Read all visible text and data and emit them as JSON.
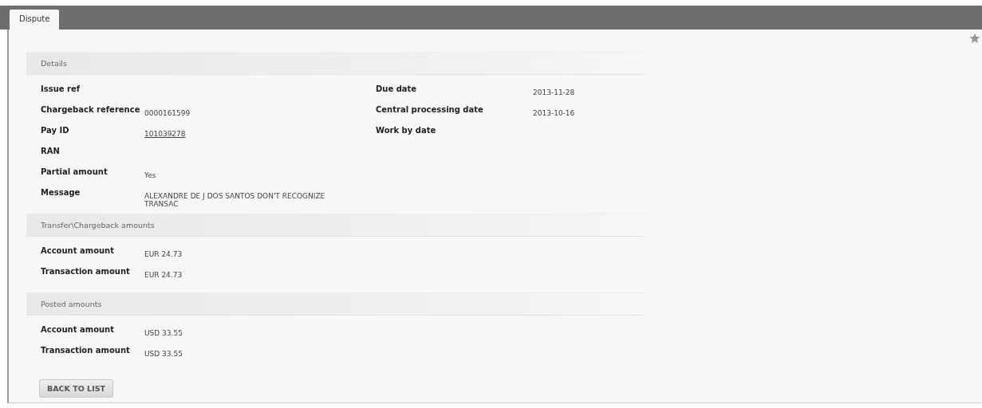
{
  "tabs": [
    {
      "label": "Dispute",
      "selected": true
    }
  ],
  "sections": [
    {
      "title": "Details",
      "columns": [
        [
          {
            "label": "Issue ref"
          },
          {
            "label": "Chargeback reference",
            "value": "0000161599"
          },
          {
            "label": "Pay ID",
            "value": "101039278",
            "kind": "link"
          },
          {
            "label": "RAN"
          },
          {
            "label": "Partial amount",
            "value": "Yes"
          },
          {
            "label": "Message",
            "value": "ALEXANDRE DE J DOS SANTOS DON'T RECOGNIZE TRANSAC"
          }
        ],
        [
          {
            "label": "Due date",
            "value": "2013-11-28"
          },
          {
            "label": "Central processing date",
            "value": "2013-10-16"
          },
          {
            "label": "Work by date"
          }
        ]
      ]
    },
    {
      "title": "Transfer\\Chargeback amounts",
      "columns": [
        [
          {
            "label": "Account amount",
            "value": "EUR 24.73"
          },
          {
            "label": "Transaction amount",
            "value": "EUR 24.73"
          }
        ]
      ]
    },
    {
      "title": "Posted amounts",
      "columns": [
        [
          {
            "label": "Account amount",
            "value": "USD 33.55"
          },
          {
            "label": "Transaction amount",
            "value": "USD 33.55"
          }
        ]
      ]
    }
  ],
  "button": "BACK TO LIST"
}
